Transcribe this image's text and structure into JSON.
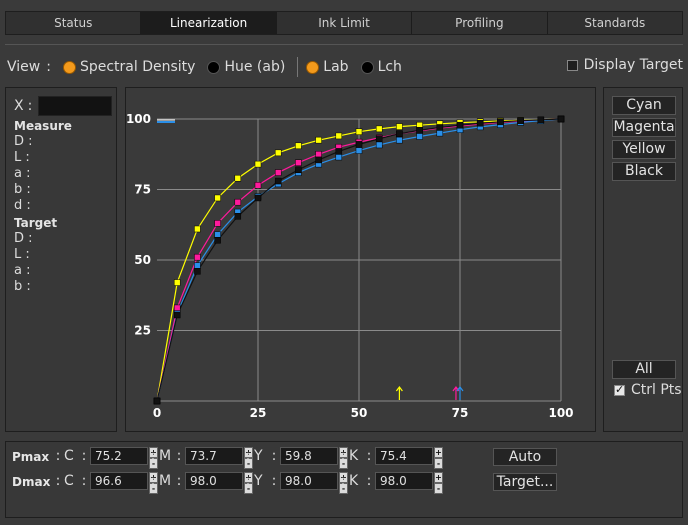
{
  "tabs": [
    {
      "label": "Status",
      "active": false
    },
    {
      "label": "Linearization",
      "active": true
    },
    {
      "label": "Ink Limit",
      "active": false
    },
    {
      "label": "Profiling",
      "active": false
    },
    {
      "label": "Standards",
      "active": false
    }
  ],
  "view": {
    "label": "View",
    "colon": ":",
    "options": [
      {
        "label": "Spectral Density",
        "selected": true
      },
      {
        "label": "Hue (ab)",
        "selected": false
      },
      {
        "label": "Lab",
        "selected": true
      },
      {
        "label": "Lch",
        "selected": false
      }
    ],
    "display_target": {
      "label": "Display Target",
      "checked": false
    }
  },
  "left_panel": {
    "x_label": "X",
    "x_colon": ":",
    "x_value": "",
    "measure_title": "Measure",
    "measure_rows": [
      "D :",
      "L :",
      "a :",
      "b :",
      "d :"
    ],
    "target_title": "Target",
    "target_rows": [
      "D :",
      "L :",
      "a :",
      "b :"
    ]
  },
  "right_panel": {
    "buttons": [
      "Cyan",
      "Magenta",
      "Yellow",
      "Black"
    ],
    "all_label": "All",
    "ctrl_pts_label": "Ctrl Pts",
    "ctrl_pts_checked": true
  },
  "bottom": {
    "pmax_label": "Pmax",
    "dmax_label": "Dmax",
    "colon": ":",
    "pmax": [
      {
        "ch": "C",
        "value": "75.2"
      },
      {
        "ch": "M",
        "value": "73.7"
      },
      {
        "ch": "Y",
        "value": "59.8"
      },
      {
        "ch": "K",
        "value": "75.4"
      }
    ],
    "dmax": [
      {
        "ch": "C",
        "value": "96.6"
      },
      {
        "ch": "M",
        "value": "98.0"
      },
      {
        "ch": "Y",
        "value": "98.0"
      },
      {
        "ch": "K",
        "value": "98.0"
      }
    ],
    "auto_label": "Auto",
    "target_label": "Target...",
    "spin_up": "+",
    "spin_down": "-"
  },
  "chart_data": {
    "type": "line",
    "xlim": [
      0,
      100
    ],
    "ylim": [
      0,
      100
    ],
    "x_ticks": [
      "0",
      "25",
      "50",
      "75",
      "100"
    ],
    "y_ticks": [
      "25",
      "50",
      "75",
      "100"
    ],
    "grid": true,
    "x": [
      0,
      5,
      10,
      15,
      20,
      25,
      30,
      35,
      40,
      45,
      50,
      55,
      60,
      65,
      70,
      75,
      80,
      85,
      90,
      95,
      100
    ],
    "series": [
      {
        "color": "#ffff00",
        "values": [
          0,
          42,
          61,
          72,
          79,
          84,
          88,
          90.5,
          92.5,
          94,
          95.5,
          96.5,
          97.3,
          97.8,
          98.3,
          98.7,
          99,
          99.3,
          99.5,
          99.7,
          100
        ]
      },
      {
        "color": "#ff1a9c",
        "values": [
          0,
          33,
          51,
          63,
          70.5,
          76.5,
          81,
          84.5,
          87.5,
          90,
          91.8,
          93.3,
          94.8,
          95.8,
          96.8,
          97.5,
          98.2,
          98.8,
          99.2,
          99.6,
          100
        ]
      },
      {
        "color": "#2a8fe8",
        "values": [
          0,
          31,
          48,
          59,
          67,
          72.5,
          77,
          81,
          84,
          86.5,
          88.8,
          90.8,
          92.5,
          93.8,
          95,
          96.2,
          97.2,
          98,
          98.8,
          99.4,
          100
        ]
      },
      {
        "color": "#111111",
        "values": [
          0,
          30.5,
          46,
          57,
          65.5,
          72,
          78,
          82,
          85.5,
          88.5,
          91,
          93,
          94.8,
          96,
          97,
          97.8,
          98.5,
          99,
          99.4,
          99.7,
          100
        ]
      }
    ],
    "markers": [
      {
        "x": 60,
        "color": "#ffff00"
      },
      {
        "x": 74,
        "color": "#ff1a9c"
      },
      {
        "x": 75,
        "color": "#2a8fe8"
      }
    ]
  }
}
